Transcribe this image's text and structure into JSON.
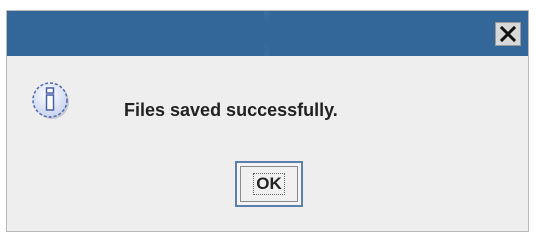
{
  "dialog": {
    "message": "Files saved successfully.",
    "ok_label": "OK",
    "icon": "info-icon",
    "close_icon": "close-icon"
  },
  "colors": {
    "titlebar": "#336699",
    "dialog_background": "#eeeeee",
    "button_focus_border": "#5a7fae"
  }
}
